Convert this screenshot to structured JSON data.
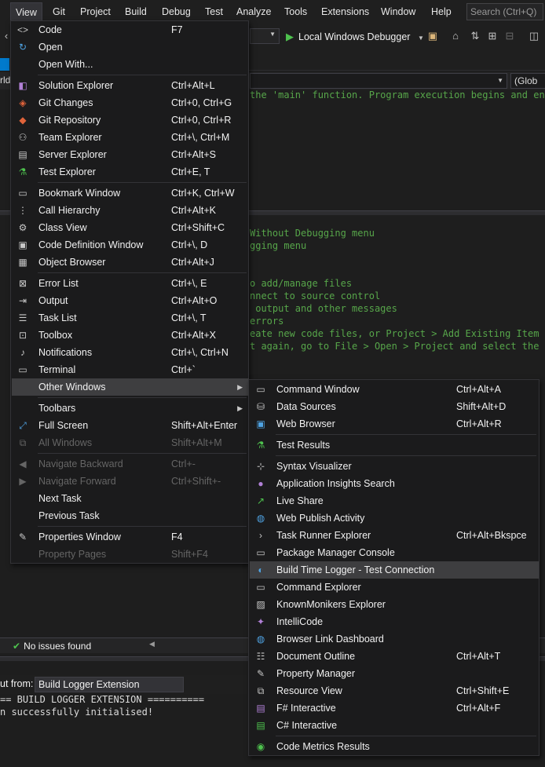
{
  "menubar": {
    "items": [
      "View",
      "Git",
      "Project",
      "Build",
      "Debug",
      "Test",
      "Analyze",
      "Tools",
      "Extensions",
      "Window",
      "Help"
    ],
    "search_placeholder": "Search (Ctrl+Q)"
  },
  "toolbar": {
    "debugger_label": "Local Windows Debugger"
  },
  "navbar": {
    "scope_label": "(Glob"
  },
  "tabstrip": {
    "left_fragment": "rld"
  },
  "editor": {
    "lines_top": [
      "the 'main' function. Program execution begins and ends"
    ],
    "lines_bottom": [
      "Without Debugging menu",
      "gging menu",
      "",
      "o add/manage files",
      "nnect to source control",
      " output and other messages",
      "errors",
      "eate new code files, or Project > Add Existing Item to",
      "t again, go to File > Open > Project and select the .s"
    ]
  },
  "status": {
    "issues_label": "No issues found"
  },
  "output": {
    "show_from_label": "ut from:",
    "source": "Build Logger Extension",
    "lines": [
      "== BUILD LOGGER EXTENSION ==========",
      "n successfully initialised!"
    ]
  },
  "view_menu": {
    "items": [
      {
        "label": "Code",
        "shortcut": "F7",
        "icon": "code-icon"
      },
      {
        "label": "Open",
        "shortcut": "",
        "icon": "open-icon"
      },
      {
        "label": "Open With...",
        "shortcut": "",
        "icon": ""
      },
      {
        "label": "Solution Explorer",
        "shortcut": "Ctrl+Alt+L",
        "icon": "solution-explorer-icon"
      },
      {
        "label": "Git Changes",
        "shortcut": "Ctrl+0, Ctrl+G",
        "icon": "git-changes-icon"
      },
      {
        "label": "Git Repository",
        "shortcut": "Ctrl+0, Ctrl+R",
        "icon": "git-repository-icon"
      },
      {
        "label": "Team Explorer",
        "shortcut": "Ctrl+\\, Ctrl+M",
        "icon": "team-explorer-icon"
      },
      {
        "label": "Server Explorer",
        "shortcut": "Ctrl+Alt+S",
        "icon": "server-explorer-icon"
      },
      {
        "label": "Test Explorer",
        "shortcut": "Ctrl+E, T",
        "icon": "test-explorer-icon"
      },
      {
        "label": "Bookmark Window",
        "shortcut": "Ctrl+K, Ctrl+W",
        "icon": "bookmark-icon"
      },
      {
        "label": "Call Hierarchy",
        "shortcut": "Ctrl+Alt+K",
        "icon": "call-hierarchy-icon"
      },
      {
        "label": "Class View",
        "shortcut": "Ctrl+Shift+C",
        "icon": "class-view-icon"
      },
      {
        "label": "Code Definition Window",
        "shortcut": "Ctrl+\\, D",
        "icon": "code-definition-icon"
      },
      {
        "label": "Object Browser",
        "shortcut": "Ctrl+Alt+J",
        "icon": "object-browser-icon"
      },
      {
        "label": "Error List",
        "shortcut": "Ctrl+\\, E",
        "icon": "error-list-icon"
      },
      {
        "label": "Output",
        "shortcut": "Ctrl+Alt+O",
        "icon": "output-icon"
      },
      {
        "label": "Task List",
        "shortcut": "Ctrl+\\, T",
        "icon": "task-list-icon"
      },
      {
        "label": "Toolbox",
        "shortcut": "Ctrl+Alt+X",
        "icon": "toolbox-icon"
      },
      {
        "label": "Notifications",
        "shortcut": "Ctrl+\\, Ctrl+N",
        "icon": "bell-icon"
      },
      {
        "label": "Terminal",
        "shortcut": "Ctrl+`",
        "icon": "terminal-icon"
      },
      {
        "label": "Other Windows",
        "shortcut": "",
        "icon": ""
      },
      {
        "label": "Toolbars",
        "shortcut": "",
        "icon": ""
      },
      {
        "label": "Full Screen",
        "shortcut": "Shift+Alt+Enter",
        "icon": "full-screen-icon"
      },
      {
        "label": "All Windows",
        "shortcut": "Shift+Alt+M",
        "icon": "all-windows-icon"
      },
      {
        "label": "Navigate Backward",
        "shortcut": "Ctrl+-",
        "icon": "navigate-back-icon"
      },
      {
        "label": "Navigate Forward",
        "shortcut": "Ctrl+Shift+-",
        "icon": "navigate-forward-icon"
      },
      {
        "label": "Next Task",
        "shortcut": "",
        "icon": ""
      },
      {
        "label": "Previous Task",
        "shortcut": "",
        "icon": ""
      },
      {
        "label": "Properties Window",
        "shortcut": "F4",
        "icon": "wrench-icon"
      },
      {
        "label": "Property Pages",
        "shortcut": "Shift+F4",
        "icon": ""
      }
    ]
  },
  "other_windows_menu": {
    "items": [
      {
        "label": "Command Window",
        "shortcut": "Ctrl+Alt+A",
        "icon": "command-window-icon"
      },
      {
        "label": "Data Sources",
        "shortcut": "Shift+Alt+D",
        "icon": "data-sources-icon"
      },
      {
        "label": "Web Browser",
        "shortcut": "Ctrl+Alt+R",
        "icon": "web-browser-icon"
      },
      {
        "label": "Test Results",
        "shortcut": "",
        "icon": "test-results-icon"
      },
      {
        "label": "Syntax Visualizer",
        "shortcut": "",
        "icon": "syntax-visualizer-icon"
      },
      {
        "label": "Application Insights Search",
        "shortcut": "",
        "icon": "app-insights-icon"
      },
      {
        "label": "Live Share",
        "shortcut": "",
        "icon": "live-share-icon"
      },
      {
        "label": "Web Publish Activity",
        "shortcut": "",
        "icon": "globe-icon"
      },
      {
        "label": "Task Runner Explorer",
        "shortcut": "Ctrl+Alt+Bkspce",
        "icon": "chevron-right-icon"
      },
      {
        "label": "Package Manager Console",
        "shortcut": "",
        "icon": "console-icon"
      },
      {
        "label": "Build Time Logger - Test Connection",
        "shortcut": "",
        "icon": "build-logger-icon"
      },
      {
        "label": "Command Explorer",
        "shortcut": "",
        "icon": "command-explorer-icon"
      },
      {
        "label": "KnownMonikers Explorer",
        "shortcut": "",
        "icon": "image-icon"
      },
      {
        "label": "IntelliCode",
        "shortcut": "",
        "icon": "intellicode-icon"
      },
      {
        "label": "Browser Link Dashboard",
        "shortcut": "",
        "icon": "browser-link-icon"
      },
      {
        "label": "Document Outline",
        "shortcut": "Ctrl+Alt+T",
        "icon": "document-outline-icon"
      },
      {
        "label": "Property Manager",
        "shortcut": "",
        "icon": "wrench-icon"
      },
      {
        "label": "Resource View",
        "shortcut": "Ctrl+Shift+E",
        "icon": "resource-view-icon"
      },
      {
        "label": "F# Interactive",
        "shortcut": "Ctrl+Alt+F",
        "icon": "fsharp-interactive-icon"
      },
      {
        "label": "C# Interactive",
        "shortcut": "",
        "icon": "csharp-interactive-icon"
      },
      {
        "label": "Code Metrics Results",
        "shortcut": "",
        "icon": "code-metrics-icon"
      }
    ]
  },
  "colors": {
    "menu_bg": "#1b1b1c",
    "highlight": "#3e3e40",
    "disabled": "#656565",
    "comment_green": "#57a64a",
    "success_green": "#4ec24e"
  }
}
